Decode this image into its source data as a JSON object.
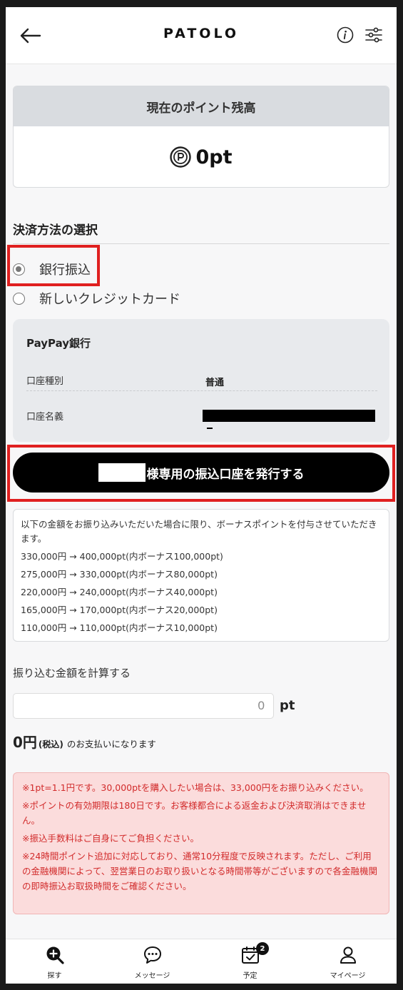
{
  "header": {
    "logo": "PATOLO"
  },
  "balance": {
    "title": "現在のポイント残高",
    "value": "0pt"
  },
  "payment_method": {
    "title": "決済方法の選択",
    "options": [
      {
        "label": "銀行振込",
        "selected": true
      },
      {
        "label": "新しいクレジットカード",
        "selected": false
      }
    ]
  },
  "bank": {
    "name": "PayPay銀行",
    "account_type_label": "口座種別",
    "account_type_value": "普通",
    "account_name_label": "口座名義"
  },
  "issue_button": {
    "label": "様専用の振込口座を発行する"
  },
  "bonus": {
    "intro": "以下の金額をお振り込みいただいた場合に限り、ボーナスポイントを付与させていただきます。",
    "tiers": [
      "330,000円 → 400,000pt(内ボーナス100,000pt)",
      "275,000円 → 330,000pt(内ボーナス80,000pt)",
      "220,000円 → 240,000pt(内ボーナス40,000pt)",
      "165,000円 → 170,000pt(内ボーナス20,000pt)",
      "110,000円 → 110,000pt(内ボーナス10,000pt)"
    ]
  },
  "calculator": {
    "title": "振り込む金額を計算する",
    "input_value": "0",
    "unit": "pt",
    "amount": "0円",
    "tax": "(税込)",
    "suffix": "のお支払いになります"
  },
  "notes": [
    "※1pt=1.1円です。30,000ptを購入したい場合は、33,000円をお振り込みください。",
    "※ポイントの有効期限は180日です。お客様都合による返金および決済取消はできません。",
    "※振込手数料はご自身にてご負担ください。",
    "※24時間ポイント追加に対応しており、通常10分程度で反映されます。ただし、ご利用の金融機関によって、翌営業日のお取り扱いとなる時間帯等がございますので各金融機関の即時振込お取扱時間をご確認ください。"
  ],
  "nav": {
    "items": [
      {
        "label": "探す",
        "icon": "search-plus-icon"
      },
      {
        "label": "メッセージ",
        "icon": "chat-bubble-icon"
      },
      {
        "label": "予定",
        "icon": "calendar-check-icon",
        "badge": "2"
      },
      {
        "label": "マイページ",
        "icon": "user-icon"
      }
    ]
  },
  "colors": {
    "highlight": "#e02020",
    "note_text": "#d22b2b",
    "note_bg": "#fbdcdc"
  }
}
